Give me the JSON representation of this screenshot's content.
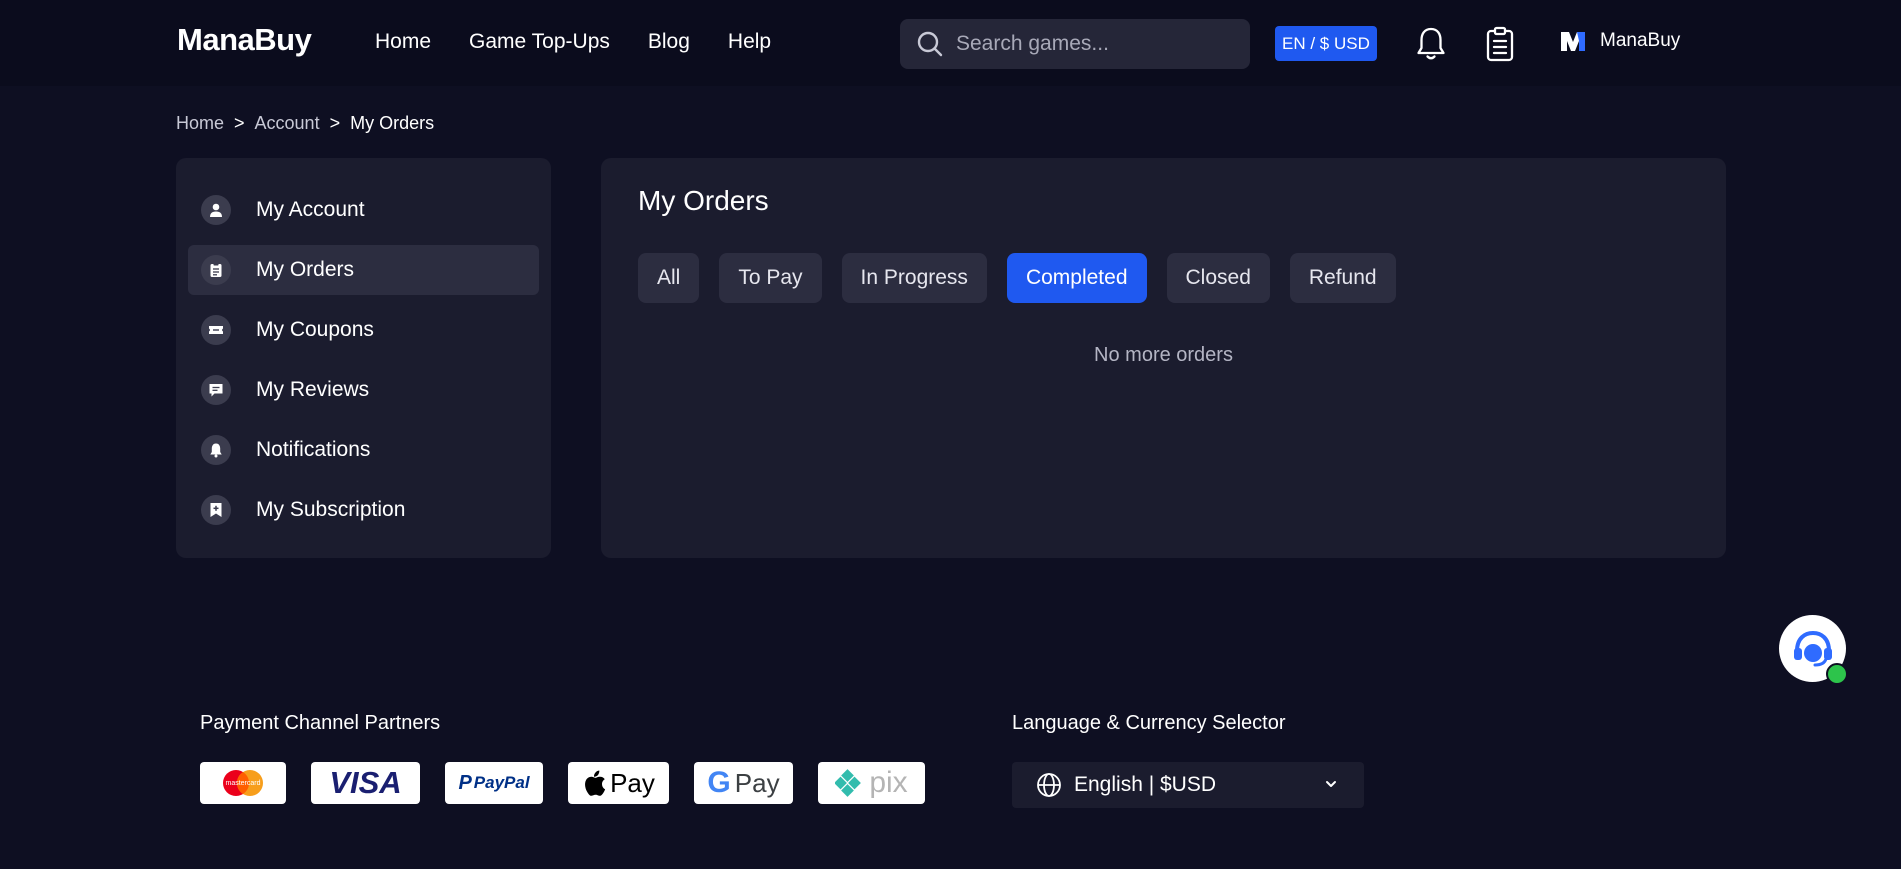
{
  "header": {
    "logo_text": "ManaBuy",
    "nav": [
      "Home",
      "Game Top-Ups",
      "Blog",
      "Help"
    ],
    "search_placeholder": "Search games...",
    "lang_button": "EN / $ USD",
    "user_name": "ManaBuy"
  },
  "breadcrumb": {
    "items": [
      "Home",
      "Account"
    ],
    "current": "My Orders",
    "separator": ">"
  },
  "sidebar": {
    "items": [
      {
        "label": "My Account",
        "icon": "user-icon"
      },
      {
        "label": "My Orders",
        "icon": "clipboard-icon",
        "active": true
      },
      {
        "label": "My Coupons",
        "icon": "ticket-icon"
      },
      {
        "label": "My Reviews",
        "icon": "comment-icon"
      },
      {
        "label": "Notifications",
        "icon": "bell-icon"
      },
      {
        "label": "My Subscription",
        "icon": "bookmark-plus-icon"
      }
    ]
  },
  "orders": {
    "title": "My Orders",
    "tabs": [
      "All",
      "To Pay",
      "In Progress",
      "Completed",
      "Closed",
      "Refund"
    ],
    "active_tab": "Completed",
    "empty_text": "No more orders"
  },
  "footer": {
    "payments_heading": "Payment Channel Partners",
    "payments": [
      "mastercard",
      "VISA",
      "PayPal",
      "Pay",
      "Pay",
      "pix"
    ],
    "language_heading": "Language & Currency Selector",
    "language_value": "English | $USD"
  },
  "colors": {
    "background": "#0e0f22",
    "header": "#0b0c1d",
    "panel": "#1b1c2e",
    "accent": "#1f59f0",
    "online": "#2dc44b"
  }
}
